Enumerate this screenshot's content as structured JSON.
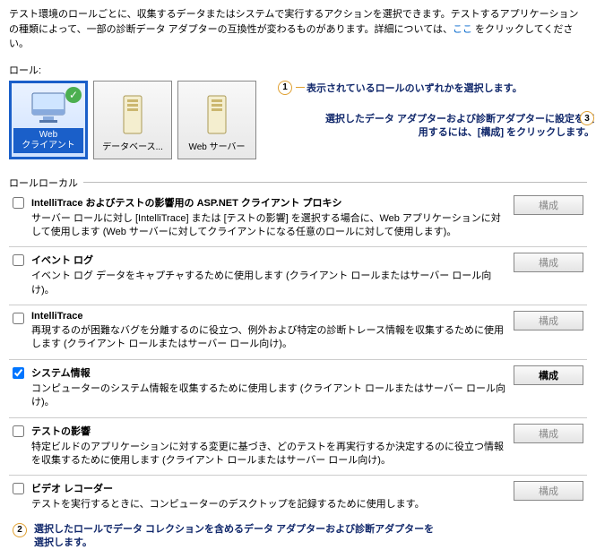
{
  "intro": {
    "text1": "テスト環境のロールごとに、収集するデータまたはシステムで実行するアクションを選択できます。テストするアプリケーションの種類によって、一部の診断データ アダプターの互換性が変わるものがあります。詳細については、",
    "link": "ここ",
    "text2": " をクリックしてください。"
  },
  "rolesLabel": "ロール:",
  "roles": [
    {
      "label": "Web\nクライアント",
      "selected": true,
      "hasCheck": true
    },
    {
      "label": "データベース...",
      "selected": false,
      "hasCheck": false
    },
    {
      "label": "Web サーバー",
      "selected": false,
      "hasCheck": false
    }
  ],
  "callouts": {
    "c1": "表示されているロールのいずれかを選択します。",
    "c3a": "選択したデータ アダプターおよび診断アダプターに設定を適",
    "c3b": "用するには、[構成] をクリックします。",
    "c2a": "選択したロールでデータ コレクションを含めるデータ アダプターおよび診断アダプターを",
    "c2b": "選択します。"
  },
  "sectionTitle": "ロールローカル",
  "configureLabel": "構成",
  "adapters": [
    {
      "name": "IntelliTrace およびテストの影響用の ASP.NET クライアント プロキシ",
      "desc": "サーバー ロールに対し [IntelliTrace] または [テストの影響] を選択する場合に、Web アプリケーションに対して使用します (Web サーバーに対してクライアントになる任意のロールに対して使用します)。",
      "checked": false,
      "enabled": false
    },
    {
      "name": "イベント ログ",
      "desc": "イベント ログ データをキャプチャするために使用します (クライアント ロールまたはサーバー ロール向け)。",
      "checked": false,
      "enabled": false
    },
    {
      "name": "IntelliTrace",
      "desc": "再現するのが困難なバグを分離するのに役立つ、例外および特定の診断トレース情報を収集するために使用します (クライアント ロールまたはサーバー ロール向け)。",
      "checked": false,
      "enabled": false
    },
    {
      "name": "システム情報",
      "desc": "コンピューターのシステム情報を収集するために使用します (クライアント ロールまたはサーバー ロール向け)。",
      "checked": true,
      "enabled": true
    },
    {
      "name": "テストの影響",
      "desc": "特定ビルドのアプリケーションに対する変更に基づき、どのテストを再実行するか決定するのに役立つ情報を収集するために使用します (クライアント ロールまたはサーバー ロール向け)。",
      "checked": false,
      "enabled": false
    },
    {
      "name": "ビデオ レコーダー",
      "desc": "テストを実行するときに、コンピューターのデスクトップを記録するために使用します。",
      "checked": false,
      "enabled": false
    }
  ]
}
